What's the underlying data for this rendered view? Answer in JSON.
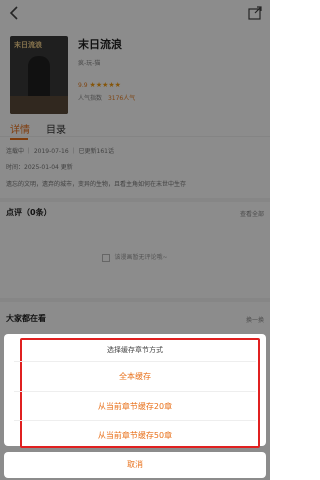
{
  "book": {
    "title": "末日流浪",
    "author": "疯-玩-猫",
    "rating_value": "9.9",
    "popularity_label": "人气指数",
    "popularity_value": "3176人气",
    "cover_title": "末日流浪"
  },
  "tabs": [
    {
      "label": "详情",
      "active": true
    },
    {
      "label": "目录",
      "active": false
    }
  ],
  "details": {
    "status_line": "连载中 ｜ 2019-07-16 ｜ 已更新161话",
    "update_line": "时间：2025-01-04 更新",
    "description": "遗忘的文明，遗弃的城市，变异的生物，且看主角如何在末世中生存"
  },
  "comments": {
    "title": "点评（0条）",
    "view_all": "查看全部",
    "empty_text": "该漫画暂无评论哦~"
  },
  "recommend": {
    "title": "大家都在看",
    "refresh": "换一换"
  },
  "cache_sheet": {
    "heading": "选择缓存章节方式",
    "options": [
      "全本缓存",
      "从当前章节缓存20章",
      "从当前章节缓存50章"
    ],
    "cancel": "取消"
  }
}
